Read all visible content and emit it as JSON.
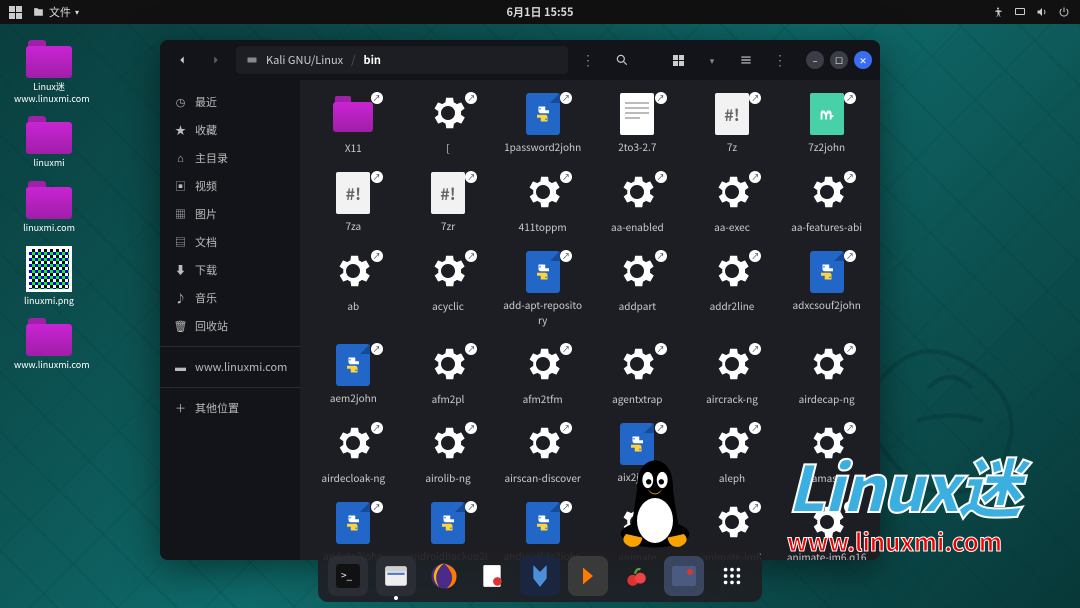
{
  "topbar": {
    "app_label": "文件",
    "datetime": "6月1日  15:55"
  },
  "desktop": [
    {
      "type": "folder",
      "label": "Linux迷 www.linuxmi.com"
    },
    {
      "type": "folder",
      "label": "linuxmi"
    },
    {
      "type": "folder",
      "label": "linuxmi.com"
    },
    {
      "type": "qr",
      "label": "linuxmi.png"
    },
    {
      "type": "folder",
      "label": "www.linuxmi.com"
    }
  ],
  "fm": {
    "path_root": "Kali GNU/Linux",
    "path_current": "bin",
    "sidebar": [
      {
        "icon": "clock",
        "label": "最近"
      },
      {
        "icon": "star",
        "label": "收藏"
      },
      {
        "icon": "home",
        "label": "主目录"
      },
      {
        "icon": "video",
        "label": "视频"
      },
      {
        "icon": "image",
        "label": "图片"
      },
      {
        "icon": "doc",
        "label": "文档"
      },
      {
        "icon": "download",
        "label": "下载"
      },
      {
        "icon": "music",
        "label": "音乐"
      },
      {
        "icon": "trash",
        "label": "回收站"
      }
    ],
    "sidebar_extra": {
      "icon": "folder",
      "label": "www.linuxmi.com"
    },
    "sidebar_other": {
      "icon": "plus",
      "label": "其他位置"
    },
    "files": [
      {
        "name": "X11",
        "kind": "folder"
      },
      {
        "name": "[",
        "kind": "gear"
      },
      {
        "name": "1password2john",
        "kind": "py"
      },
      {
        "name": "2to3-2.7",
        "kind": "txt"
      },
      {
        "name": "7z",
        "kind": "sh"
      },
      {
        "name": "7z2john",
        "kind": "perl"
      },
      {
        "name": "7za",
        "kind": "sh"
      },
      {
        "name": "7zr",
        "kind": "sh"
      },
      {
        "name": "411toppm",
        "kind": "gear"
      },
      {
        "name": "aa-enabled",
        "kind": "gear"
      },
      {
        "name": "aa-exec",
        "kind": "gear"
      },
      {
        "name": "aa-features-abi",
        "kind": "gear"
      },
      {
        "name": "ab",
        "kind": "gear"
      },
      {
        "name": "acyclic",
        "kind": "gear"
      },
      {
        "name": "add-apt-repository",
        "kind": "py"
      },
      {
        "name": "addpart",
        "kind": "gear"
      },
      {
        "name": "addr2line",
        "kind": "gear"
      },
      {
        "name": "adxcsouf2john",
        "kind": "py"
      },
      {
        "name": "aem2john",
        "kind": "py"
      },
      {
        "name": "afm2pl",
        "kind": "gear"
      },
      {
        "name": "afm2tfm",
        "kind": "gear"
      },
      {
        "name": "agentxtrap",
        "kind": "gear"
      },
      {
        "name": "aircrack-ng",
        "kind": "gear"
      },
      {
        "name": "airdecap-ng",
        "kind": "gear"
      },
      {
        "name": "airdecloak-ng",
        "kind": "gear"
      },
      {
        "name": "airolib-ng",
        "kind": "gear"
      },
      {
        "name": "airscan-discover",
        "kind": "gear"
      },
      {
        "name": "aix2john",
        "kind": "py"
      },
      {
        "name": "aleph",
        "kind": "gear"
      },
      {
        "name": "amass",
        "kind": "gear"
      },
      {
        "name": "andotp2john",
        "kind": "py"
      },
      {
        "name": "androidbackup2john",
        "kind": "py"
      },
      {
        "name": "androidfde2john",
        "kind": "py"
      },
      {
        "name": "animate",
        "kind": "gear"
      },
      {
        "name": "animate-im6",
        "kind": "gear"
      },
      {
        "name": "animate-im6.q16",
        "kind": "gear"
      }
    ]
  },
  "overlay": {
    "brand": "Linux",
    "brand_cn": "迷",
    "url": "www.linuxmi.com"
  }
}
